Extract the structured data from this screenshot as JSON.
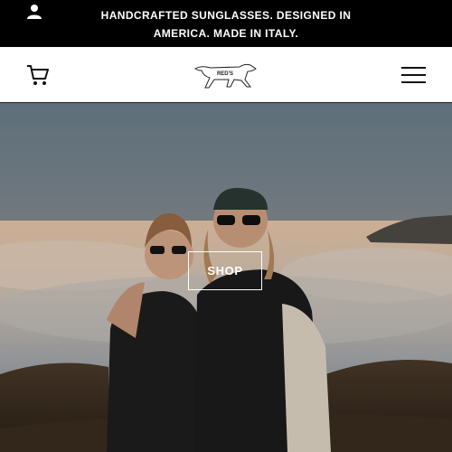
{
  "announcement": {
    "text": "HANDCRAFTED SUNGLASSES. DESIGNED IN AMERICA. MADE IN ITALY."
  },
  "header": {
    "logo_text": "RED'S",
    "account_icon": "user-icon",
    "cart_icon": "cart-icon",
    "menu_icon": "hamburger-menu-icon"
  },
  "hero": {
    "button_label": "SHOP"
  },
  "colors": {
    "bar": "#000000",
    "header_bg": "#ffffff",
    "text_light": "#ffffff"
  }
}
